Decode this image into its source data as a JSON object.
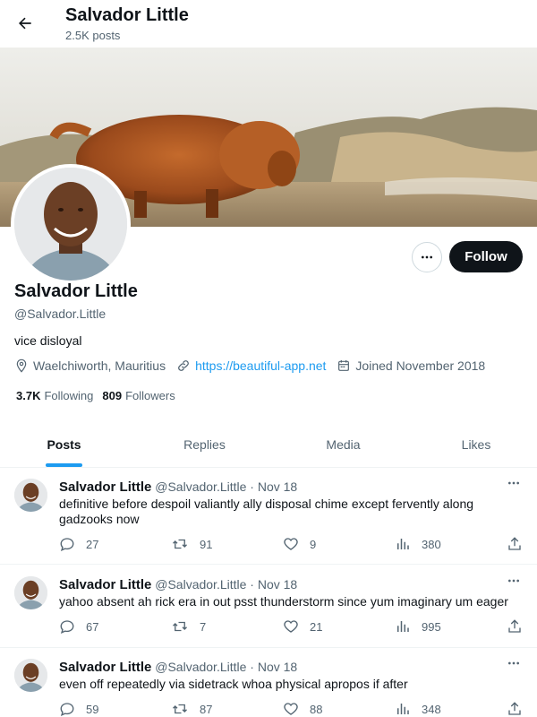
{
  "header": {
    "name": "Salvador Little",
    "post_count": "2.5K posts"
  },
  "profile": {
    "name": "Salvador Little",
    "handle": "@Salvador.Little",
    "bio": "vice disloyal",
    "location": "Waelchiworth, Mauritius",
    "website": "https://beautiful-app.net",
    "joined": "Joined November 2018",
    "following_count": "3.7K",
    "following_label": "Following",
    "followers_count": "809",
    "followers_label": "Followers",
    "follow_label": "Follow"
  },
  "tabs": [
    {
      "label": "Posts"
    },
    {
      "label": "Replies"
    },
    {
      "label": "Media"
    },
    {
      "label": "Likes"
    }
  ],
  "posts": [
    {
      "name": "Salvador Little",
      "handle_date": "@Salvador.Little · Nov 18",
      "text": "definitive before despoil valiantly ally disposal chime except fervently along gadzooks now",
      "replies": "27",
      "reposts": "91",
      "likes": "9",
      "views": "380"
    },
    {
      "name": "Salvador Little",
      "handle_date": "@Salvador.Little · Nov 18",
      "text": "yahoo absent ah rick era in out psst thunderstorm since yum imaginary um eager",
      "replies": "67",
      "reposts": "7",
      "likes": "21",
      "views": "995"
    },
    {
      "name": "Salvador Little",
      "handle_date": "@Salvador.Little · Nov 18",
      "text": "even off repeatedly via sidetrack whoa physical apropos if after",
      "replies": "59",
      "reposts": "87",
      "likes": "88",
      "views": "348"
    }
  ],
  "icons": {
    "back": "arrow-left-icon",
    "more": "more-horizontal-icon",
    "location": "location-pin-icon",
    "link": "link-icon",
    "calendar": "calendar-icon",
    "reply": "reply-icon",
    "repost": "repost-icon",
    "like": "heart-icon",
    "views": "views-chart-icon",
    "share": "share-icon"
  },
  "colors": {
    "accent": "#1d9bf0",
    "text": "#0f1419",
    "muted": "#536471",
    "follow_bg": "#0f1419"
  }
}
